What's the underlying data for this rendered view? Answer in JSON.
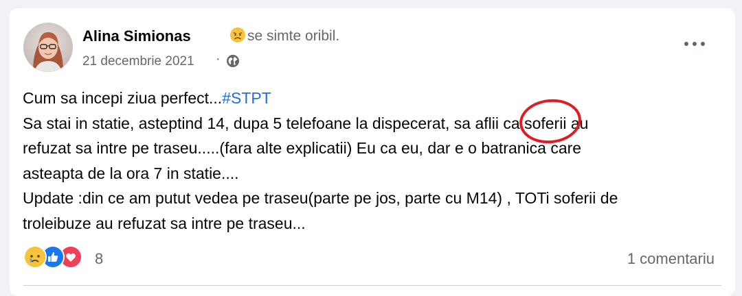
{
  "post": {
    "author": "Alina Simionas",
    "feeling_emoji": "sad-face-icon",
    "feeling": "se simte oribil.",
    "date": "21 decembrie 2021",
    "date_separator": "·",
    "privacy_icon": "globe-icon",
    "more_icon": "more-options-icon",
    "text": {
      "line1_prefix": "Cum sa incepi ziua perfect...",
      "line1_hashtag": "#STPT",
      "line2": "Sa stai in statie, asteptind 14, dupa 5 telefoane la dispecerat, sa aflii  ca soferii au",
      "line3": "refuzat sa intre pe traseu.....(fara alte explicatii) Eu ca eu, dar e o batranica care",
      "line4": "asteapta de la ora 7 in statie....",
      "line5": "Update :din ce am putut vedea pe traseu(parte pe jos, parte cu M14) , TOTi soferii de",
      "line6": "troleibuze au refuzat sa intre pe traseu..."
    },
    "reactions": {
      "icons": [
        "sad-reaction-icon",
        "like-reaction-icon",
        "love-reaction-icon"
      ],
      "count": "8"
    },
    "comments_label": "1 comentariu"
  },
  "colors": {
    "hashtag": "#216fdb",
    "annotation_ring": "#e21b23",
    "secondary_text": "#65676b"
  }
}
